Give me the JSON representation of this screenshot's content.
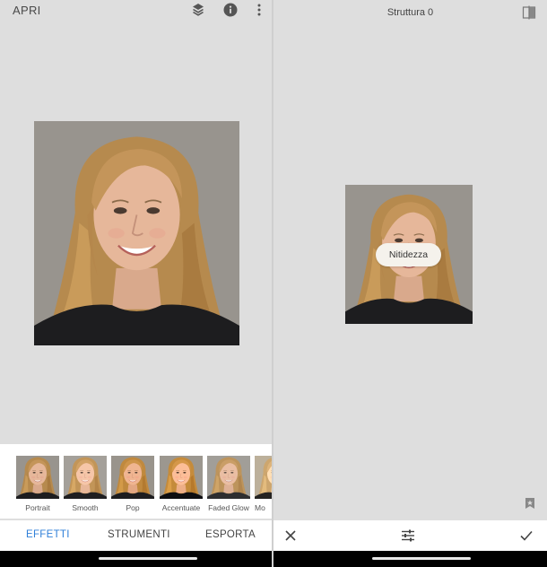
{
  "left": {
    "header": {
      "open_label": "APRI",
      "icons": [
        "layers-icon",
        "info-icon",
        "more-vert-icon"
      ]
    },
    "filters": [
      {
        "label": "Portrait"
      },
      {
        "label": "Smooth"
      },
      {
        "label": "Pop"
      },
      {
        "label": "Accentuate"
      },
      {
        "label": "Faded Glow"
      },
      {
        "label": "Mo"
      }
    ],
    "tabs": [
      {
        "label": "EFFETTI",
        "active": true
      },
      {
        "label": "STRUMENTI",
        "active": false
      },
      {
        "label": "ESPORTA",
        "active": false
      }
    ]
  },
  "right": {
    "header": {
      "title": "Struttura 0",
      "icons": [
        "compare-icon"
      ]
    },
    "tooltip": "Nitidezza",
    "toolbar": {
      "icons": [
        "close-icon",
        "tune-icon",
        "check-icon"
      ]
    }
  },
  "colors": {
    "accent": "#2f7fd8",
    "background": "#dedede",
    "panel": "#ffffff"
  }
}
